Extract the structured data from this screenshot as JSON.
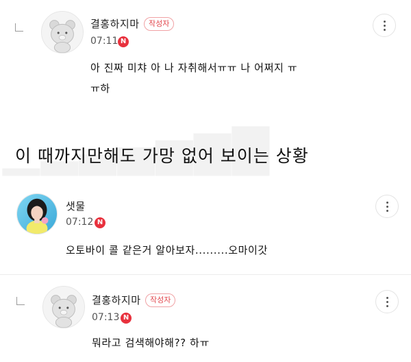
{
  "comments": [
    {
      "name": "결홍하지마",
      "author_badge": "작성자",
      "time": "07:11",
      "new_badge": "N",
      "message_line1": "아 진짜 미챠 아 나 자취해서ㅠㅠ 나 어쩌지 ㅠ",
      "message_line2": "ㅠ하",
      "avatar_icon": "bear-avatar-icon"
    },
    {
      "name": "샛물",
      "time": "07:12",
      "new_badge": "N",
      "message_line1": "오토바이 콜 같은거 알아보자.........오마이갓",
      "avatar_icon": "profile-photo"
    },
    {
      "name": "결홍하지마",
      "author_badge": "작성자",
      "time": "07:13",
      "new_badge": "N",
      "message_line1": "뭐라고 검색해야해?? 하ㅠ",
      "avatar_icon": "bear-avatar-icon"
    }
  ],
  "caption": {
    "text": "이 때까지만해도 가망 없어 보이는 상황"
  },
  "colors": {
    "accent_red": "#e8313d",
    "author_badge": "#e2474d"
  }
}
